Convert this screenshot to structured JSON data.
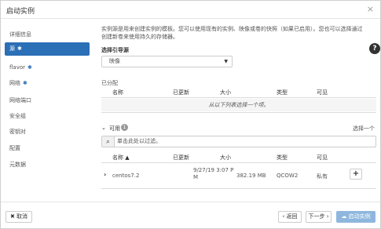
{
  "dialog": {
    "title": "启动实例",
    "close_icon": "×"
  },
  "help_icon": "?",
  "sidebar": {
    "items": [
      {
        "label": "详细信息",
        "required": ""
      },
      {
        "label": "源",
        "required": "✱"
      },
      {
        "label": "flavor",
        "required": "✱"
      },
      {
        "label": "网络",
        "required": "✱"
      },
      {
        "label": "网络端口",
        "required": ""
      },
      {
        "label": "安全组",
        "required": ""
      },
      {
        "label": "密钥对",
        "required": ""
      },
      {
        "label": "配置",
        "required": ""
      },
      {
        "label": "元数据",
        "required": ""
      }
    ],
    "active_index": 1
  },
  "content": {
    "description": "实例源是用来创建实例的模板。您可以使用现有的实例、映像或卷的快照（如果已启用）。您也可以选择通过创建新卷来使用持久的存储器。",
    "boot_source_label": "选择引导源",
    "boot_source_value": "映像",
    "allocated_label": "已分配",
    "allocated_headers": [
      "名称",
      "已更新",
      "大小",
      "类型",
      "可见"
    ],
    "allocated_empty": "从以下列表选择一个项。",
    "available_label": "可用",
    "available_count": "1",
    "select_one": "选择一个",
    "filter_placeholder": "单击此处以过滤。",
    "available_headers": [
      "名称 ▲",
      "已更新",
      "大小",
      "类型",
      "可见"
    ],
    "rows": [
      {
        "name": "centos7.2",
        "updated_line1": "9/27/19 3:07 P",
        "updated_line2": "M",
        "size": "382.19 MB",
        "type": "QCOW2",
        "visibility": "私有"
      }
    ]
  },
  "footer": {
    "cancel_label": "✖ 取消",
    "back_label": "‹ 返回",
    "next_label": "下一步 ›",
    "launch_label": "☁ 启动实例"
  },
  "colors": {
    "accent": "#2b6fb6",
    "launch_disabled": "#8fb7de"
  }
}
